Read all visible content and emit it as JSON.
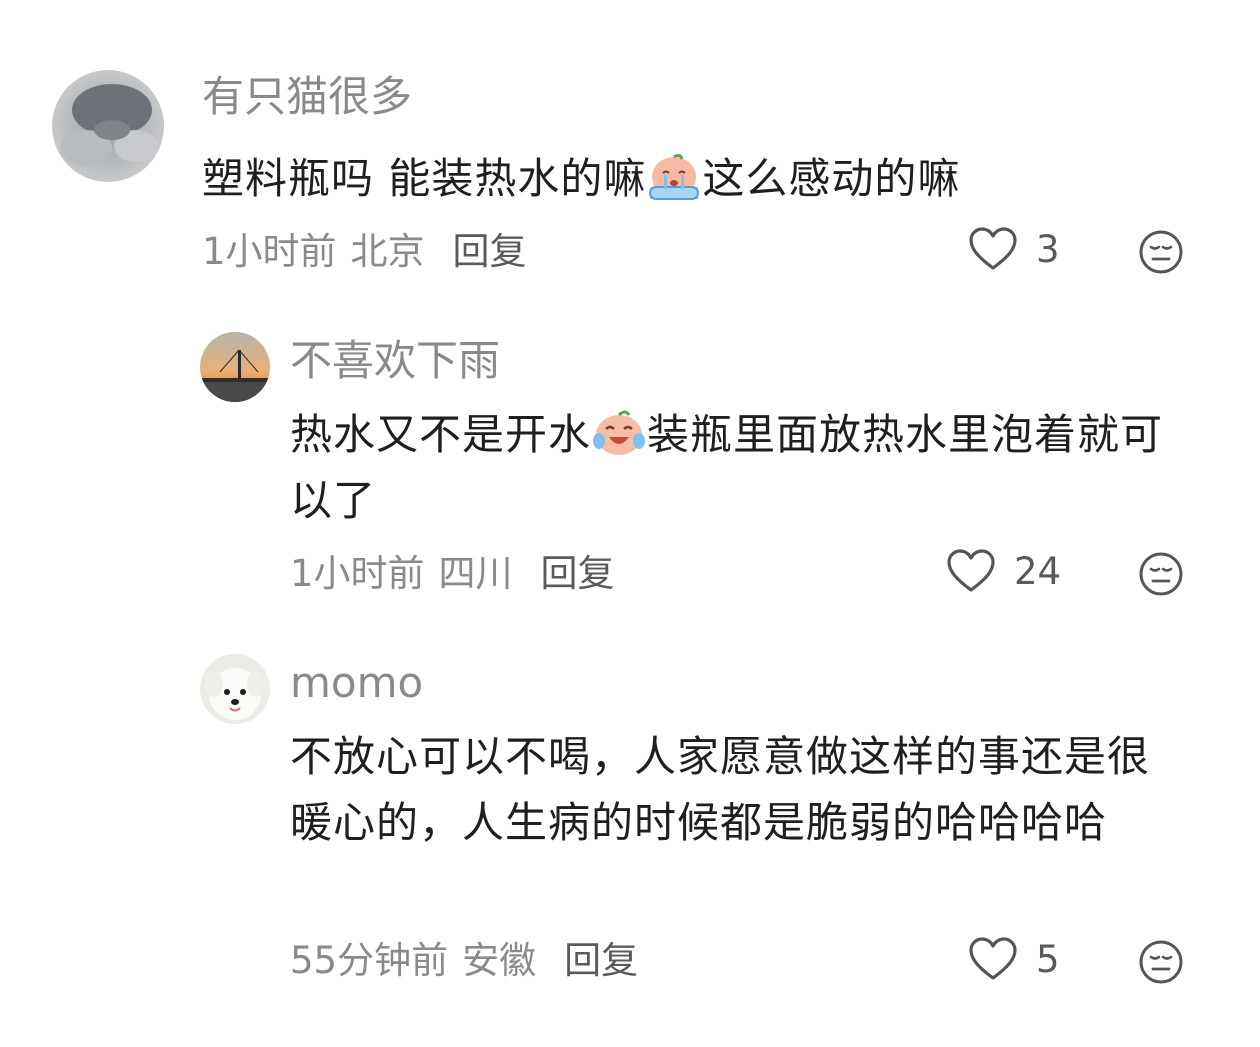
{
  "comments": [
    {
      "username": "有只猫很多",
      "text_before": "塑料瓶吗 能装热水的嘛",
      "emoji": "crying-face-emoji",
      "text_after": "这么感动的嘛",
      "time": "1小时前",
      "location": "北京",
      "reply": "回复",
      "likes": "3"
    },
    {
      "username": "不喜欢下雨",
      "text_before": "热水又不是开水",
      "emoji": "crying-laughing-face-emoji",
      "text_after": "装瓶里面放热水里泡着就可以了",
      "time": "1小时前",
      "location": "四川",
      "reply": "回复",
      "likes": "24"
    },
    {
      "username": "momo",
      "text": "不放心可以不喝，人家愿意做这样的事还是很暖心的，人生病的时候都是脆弱的哈哈哈哈",
      "time": "55分钟前",
      "location": "安徽",
      "reply": "回复",
      "likes": "5"
    }
  ],
  "colors": {
    "username": "#8a8a8a",
    "text": "#1f1f1f",
    "meta": "#8a8a8a",
    "icon": "#555555"
  }
}
